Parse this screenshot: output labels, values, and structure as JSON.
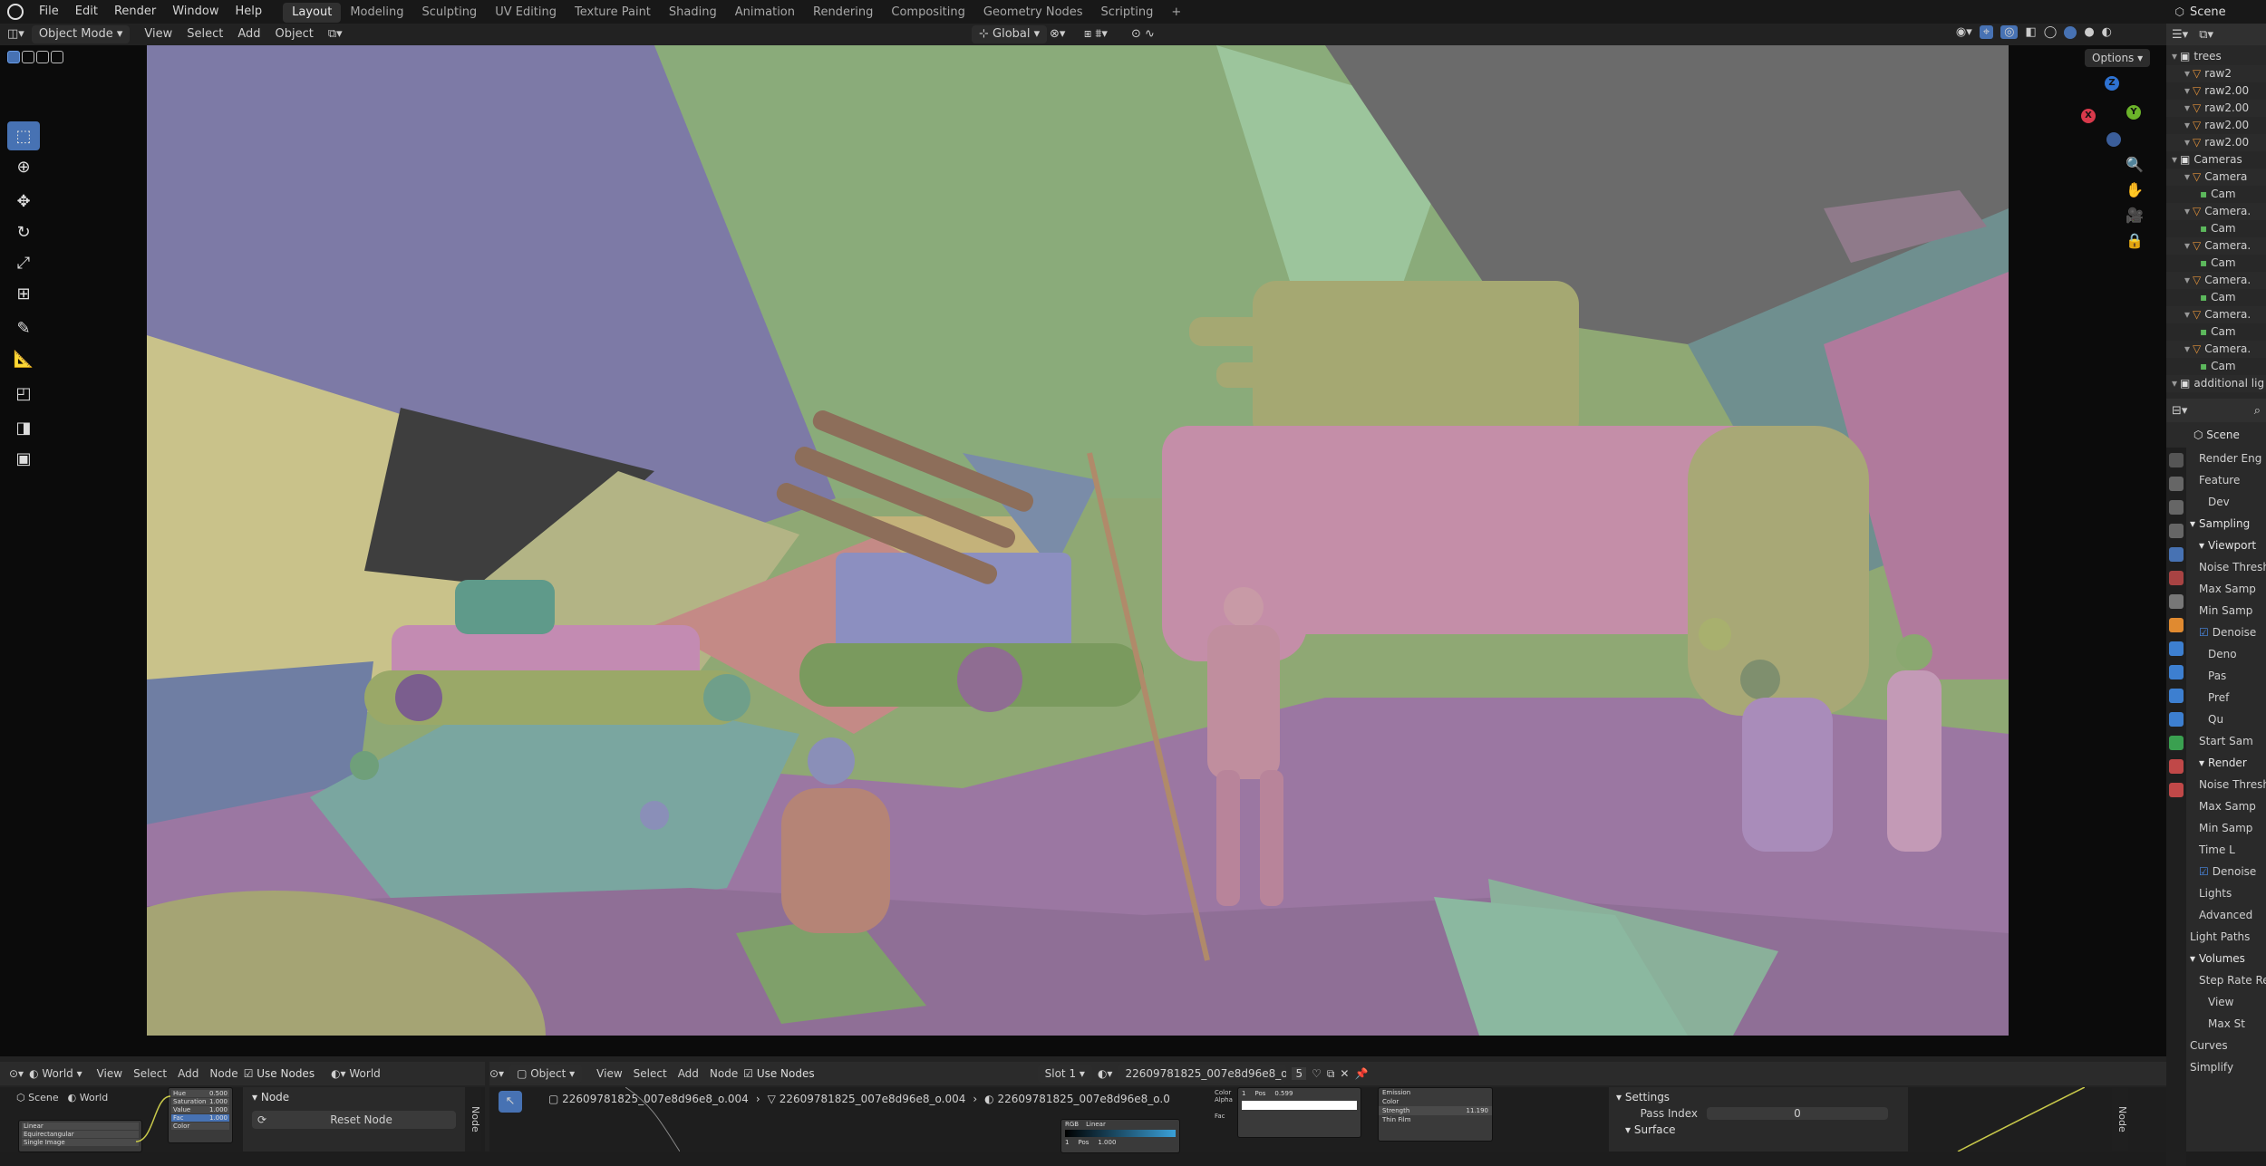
{
  "menu": [
    "File",
    "Edit",
    "Render",
    "Window",
    "Help"
  ],
  "workspaces": [
    "Layout",
    "Modeling",
    "Sculpting",
    "UV Editing",
    "Texture Paint",
    "Shading",
    "Animation",
    "Rendering",
    "Compositing",
    "Geometry Nodes",
    "Scripting",
    "+"
  ],
  "scene_name": "Scene",
  "viewport_header": {
    "mode": "Object Mode",
    "menus": [
      "View",
      "Select",
      "Add",
      "Object"
    ],
    "transform": "Global",
    "options": "Options"
  },
  "outliner": [
    {
      "label": "trees",
      "indent": 0
    },
    {
      "label": "raw2",
      "indent": 1
    },
    {
      "label": "raw2.00",
      "indent": 1
    },
    {
      "label": "raw2.00",
      "indent": 1
    },
    {
      "label": "raw2.00",
      "indent": 1
    },
    {
      "label": "raw2.00",
      "indent": 1
    },
    {
      "label": "Cameras",
      "indent": 0
    },
    {
      "label": "Camera",
      "indent": 1
    },
    {
      "label": "Cam",
      "indent": 2
    },
    {
      "label": "Camera.",
      "indent": 1
    },
    {
      "label": "Cam",
      "indent": 2
    },
    {
      "label": "Camera.",
      "indent": 1
    },
    {
      "label": "Cam",
      "indent": 2
    },
    {
      "label": "Camera.",
      "indent": 1
    },
    {
      "label": "Cam",
      "indent": 2
    },
    {
      "label": "Camera.",
      "indent": 1
    },
    {
      "label": "Cam",
      "indent": 2
    },
    {
      "label": "Camera.",
      "indent": 1
    },
    {
      "label": "Cam",
      "indent": 2
    },
    {
      "label": "additional lig",
      "indent": 0
    }
  ],
  "properties": {
    "context": "Scene",
    "rows": [
      {
        "label": "Render Eng",
        "indent": 1
      },
      {
        "label": "Feature",
        "indent": 1
      },
      {
        "label": "Dev",
        "indent": 2
      },
      {
        "label": "Sampling",
        "indent": 0,
        "header": true
      },
      {
        "label": "Viewport",
        "indent": 1,
        "header": true
      },
      {
        "label": "Noise Thresh",
        "indent": 1
      },
      {
        "label": "Max Samp",
        "indent": 1
      },
      {
        "label": "Min Samp",
        "indent": 1
      },
      {
        "label": "Denoise",
        "indent": 1,
        "check": true
      },
      {
        "label": "Deno",
        "indent": 2
      },
      {
        "label": "Pas",
        "indent": 2
      },
      {
        "label": "Pref",
        "indent": 2
      },
      {
        "label": "Qu",
        "indent": 2
      },
      {
        "label": "Start Sam",
        "indent": 1
      },
      {
        "label": "Render",
        "indent": 1,
        "header": true
      },
      {
        "label": "Noise Thresh",
        "indent": 1
      },
      {
        "label": "Max Samp",
        "indent": 1
      },
      {
        "label": "Min Samp",
        "indent": 1
      },
      {
        "label": "Time L",
        "indent": 1
      },
      {
        "label": "Denoise",
        "indent": 1,
        "check": true
      },
      {
        "label": "Lights",
        "indent": 1
      },
      {
        "label": "Advanced",
        "indent": 1
      },
      {
        "label": "Light Paths",
        "indent": 0
      },
      {
        "label": "Volumes",
        "indent": 0,
        "header": true
      },
      {
        "label": "Step Rate Ren",
        "indent": 1
      },
      {
        "label": "View",
        "indent": 2
      },
      {
        "label": "Max St",
        "indent": 2
      },
      {
        "label": "Curves",
        "indent": 0
      },
      {
        "label": "Simplify",
        "indent": 0
      }
    ]
  },
  "bottom_left": {
    "world_label": "World",
    "menus": [
      "View",
      "Select",
      "Add",
      "Node"
    ],
    "use_nodes": "Use Nodes",
    "world_slot": "World",
    "scene": "Scene",
    "world2": "World",
    "node_panel": "Node",
    "reset_node": "Reset Node",
    "node_tab": "Node",
    "rows": [
      "Linear",
      "Equirectangular",
      "Single Image"
    ],
    "mini_rows": [
      {
        "label": "Hue",
        "value": "0.500"
      },
      {
        "label": "Saturation",
        "value": "1.000"
      },
      {
        "label": "Value",
        "value": "1.000"
      },
      {
        "label": "Fac",
        "value": "1.000"
      },
      {
        "label": "Color",
        "value": ""
      }
    ]
  },
  "bottom_right": {
    "object_dd": "Object",
    "menus": [
      "View",
      "Select",
      "Add",
      "Node"
    ],
    "use_nodes": "Use Nodes",
    "slot": "Slot 1",
    "material": "22609781825_007e8d96e8_o.0",
    "users": "5",
    "breadcrumb": [
      "22609781825_007e8d96e8_o.004",
      "22609781825_007e8d96e8_o.004",
      "22609781825_007e8d96e8_o.0"
    ],
    "settings": "Settings",
    "pass_index_label": "Pass Index",
    "pass_index_value": "0",
    "surface": "Surface",
    "node_tab": "Node",
    "node_texts": {
      "rgb": "RGB",
      "linear": "Linear",
      "one": "1",
      "pos": "Pos",
      "pos_val": "0.599",
      "one_b": "1",
      "pos_b": "Pos",
      "pos_val_b": "1.000",
      "emission": "Emission",
      "color": "Color",
      "strength": "Strength",
      "strength_val": "11.190",
      "fac": "Fac",
      "alpha": "Alpha",
      "thin_film": "Thin Film"
    }
  }
}
